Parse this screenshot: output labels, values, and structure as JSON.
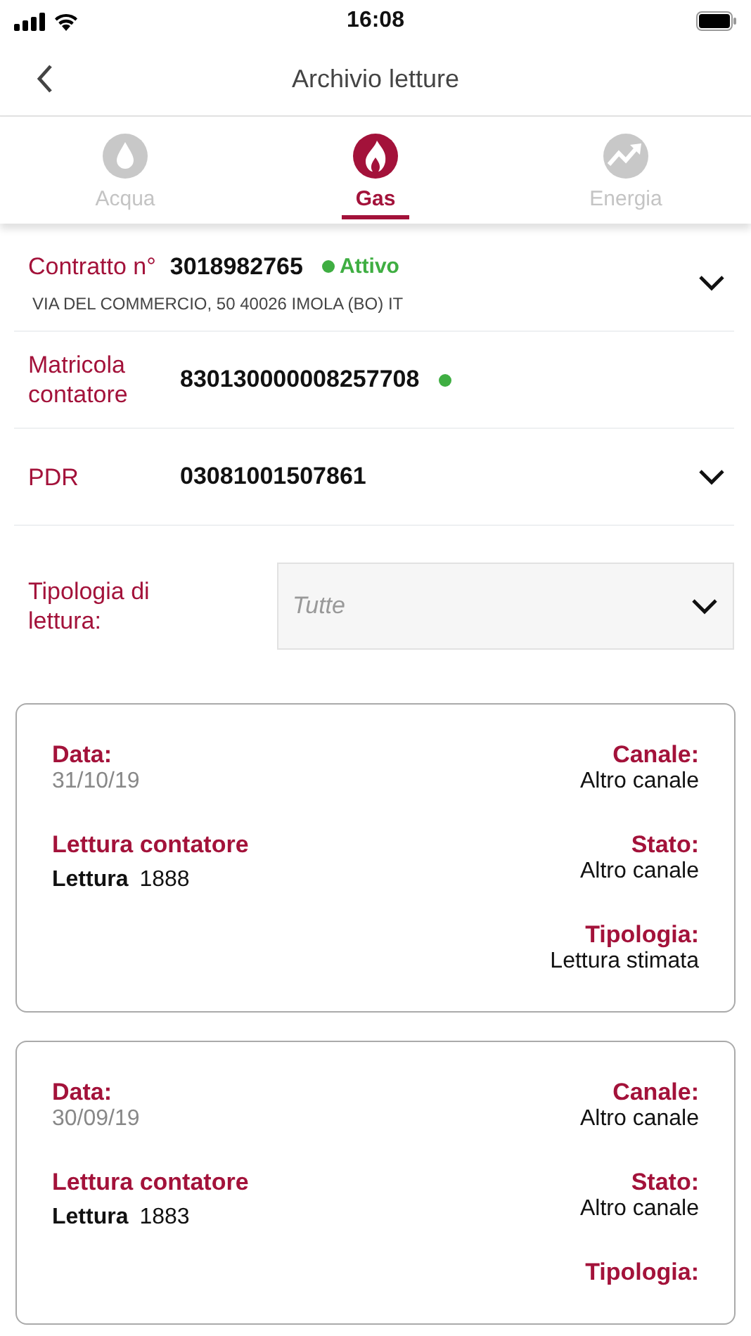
{
  "status_bar": {
    "time": "16:08"
  },
  "header": {
    "title": "Archivio letture"
  },
  "tabs": [
    {
      "label": "Acqua",
      "kind": "water",
      "selected": false
    },
    {
      "label": "Gas",
      "kind": "gas",
      "selected": true
    },
    {
      "label": "Energia",
      "kind": "energy",
      "selected": false
    }
  ],
  "contract": {
    "label": "Contratto n°",
    "number": "3018982765",
    "status": "Attivo",
    "active": true,
    "address": "VIA DEL COMMERCIO, 50 40026 IMOLA (BO) IT"
  },
  "meter": {
    "label": "Matricola contatore",
    "value": "830130000008257708",
    "active": true
  },
  "pdr": {
    "label": "PDR",
    "value": "03081001507861"
  },
  "filter": {
    "label": "Tipologia di lettura:",
    "placeholder": "Tutte"
  },
  "readings": [
    {
      "date_label": "Data:",
      "date": "31/10/19",
      "reading_label": "Lettura contatore",
      "reading_prefix": "Lettura",
      "reading": "1888",
      "channel_label": "Canale:",
      "channel": "Altro canale",
      "state_label": "Stato:",
      "state": "Altro canale",
      "type_label": "Tipologia:",
      "type": "Lettura stimata"
    },
    {
      "date_label": "Data:",
      "date": "30/09/19",
      "reading_label": "Lettura contatore",
      "reading_prefix": "Lettura",
      "reading": "1883",
      "channel_label": "Canale:",
      "channel": "Altro canale",
      "state_label": "Stato:",
      "state": "Altro canale",
      "type_label": "Tipologia:"
    }
  ]
}
